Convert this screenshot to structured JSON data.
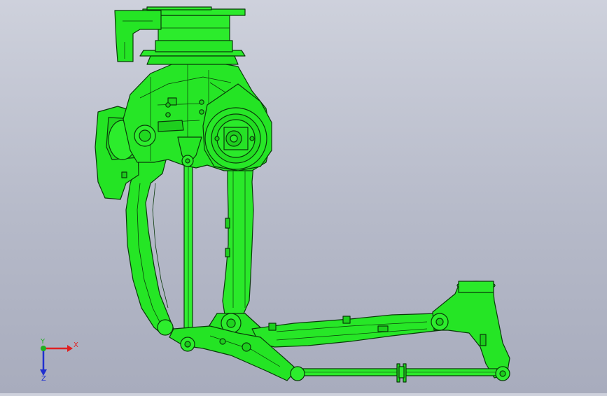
{
  "app": {
    "type": "cad-3d-viewport"
  },
  "model": {
    "name": "robot-arm-assembly",
    "color": "#22ee22",
    "edge_color": "#0a3a0a"
  },
  "triad": {
    "x_label": "X",
    "y_label": "Y",
    "z_label": "Z",
    "x_color": "#e02020",
    "y_color": "#20b020",
    "z_color": "#2030d0"
  }
}
